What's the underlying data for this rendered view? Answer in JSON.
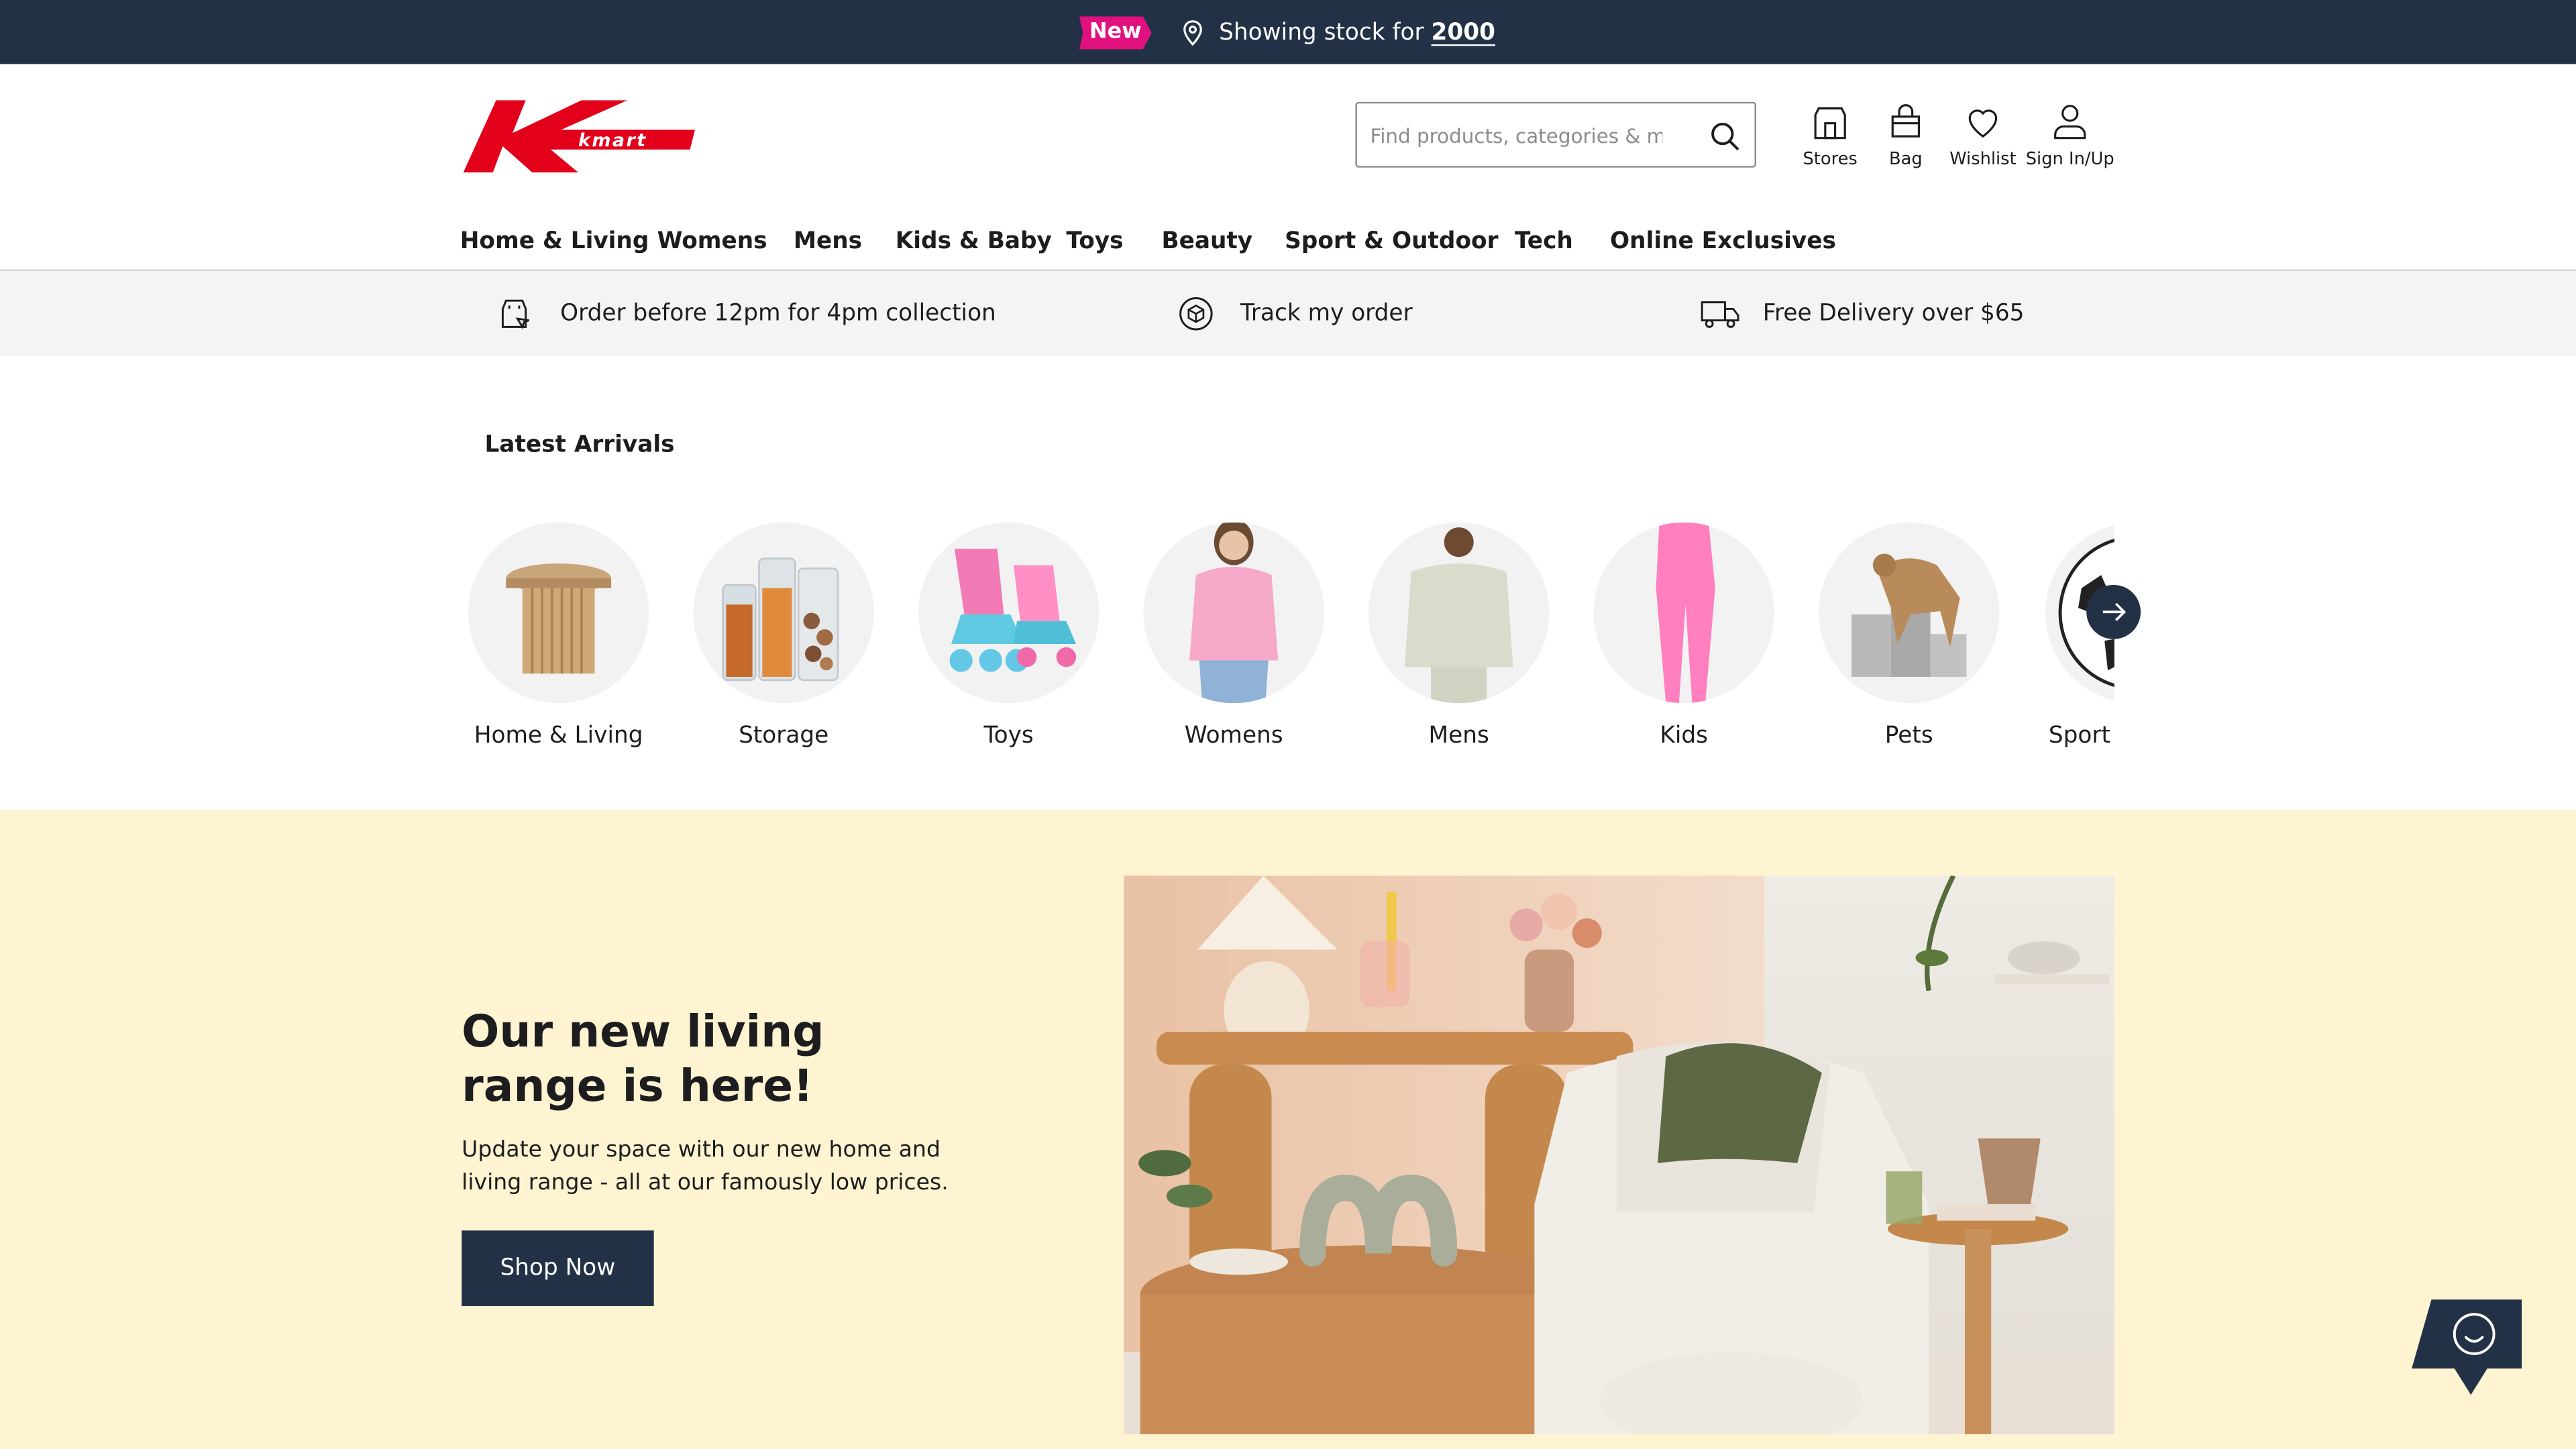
{
  "topbar": {
    "badge": "New",
    "stock_prefix": "Showing stock for",
    "stock_postcode": "2000"
  },
  "header": {
    "logo_text": "kmart",
    "search_placeholder": "Find products, categories & more",
    "icons": [
      {
        "label": "Stores",
        "icon": "store-icon"
      },
      {
        "label": "Bag",
        "icon": "bag-icon"
      },
      {
        "label": "Wishlist",
        "icon": "heart-icon"
      },
      {
        "label": "Sign In/Up",
        "icon": "user-icon"
      }
    ]
  },
  "nav": {
    "items": [
      "Home & Living",
      "Womens",
      "Mens",
      "Kids & Baby",
      "Toys",
      "Beauty",
      "Sport & Outdoor",
      "Tech",
      "Online Exclusives"
    ]
  },
  "strip": {
    "items": [
      {
        "label": "Order before 12pm for 4pm collection",
        "icon": "click-collect-icon"
      },
      {
        "label": "Track my order",
        "icon": "parcel-icon"
      },
      {
        "label": "Free Delivery over $65",
        "icon": "truck-icon"
      }
    ]
  },
  "latest": {
    "title": "Latest Arrivals",
    "categories": [
      "Home & Living",
      "Storage",
      "Toys",
      "Womens",
      "Mens",
      "Kids",
      "Pets",
      "Sport"
    ]
  },
  "hero": {
    "title_line1": "Our new living",
    "title_line2": "range is here!",
    "subtitle": "Update your space with our new home and living range - all at our famously low prices.",
    "cta": "Shop Now"
  },
  "colors": {
    "navy": "#223146",
    "brand_red": "#e2001a",
    "badge_pink": "#e0117f",
    "hero_bg": "#fff4d1"
  }
}
